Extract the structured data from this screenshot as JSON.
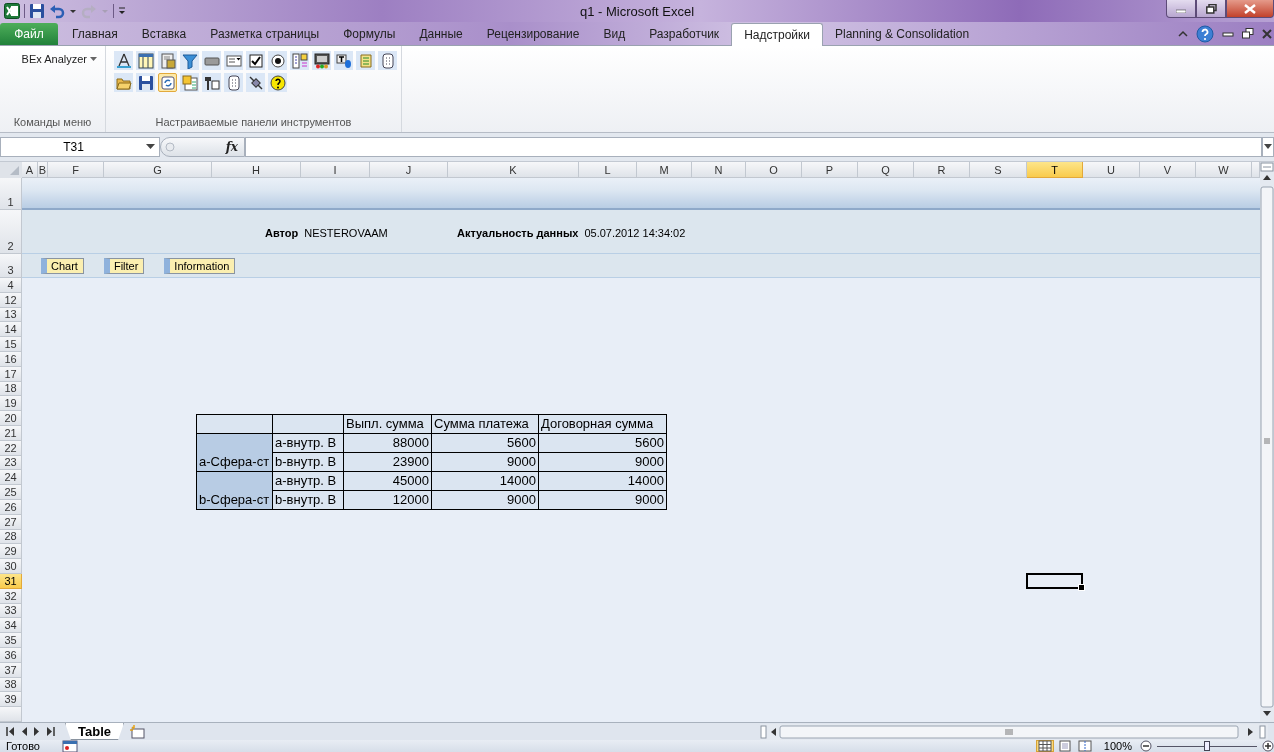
{
  "window": {
    "title": "q1  -  Microsoft Excel"
  },
  "ribbon_tabs": [
    {
      "label": "Файл",
      "selected": false,
      "kind": "file"
    },
    {
      "label": "Главная",
      "selected": false,
      "kind": "tab"
    },
    {
      "label": "Вставка",
      "selected": false,
      "kind": "tab"
    },
    {
      "label": "Разметка страницы",
      "selected": false,
      "kind": "tab"
    },
    {
      "label": "Формулы",
      "selected": false,
      "kind": "tab"
    },
    {
      "label": "Данные",
      "selected": false,
      "kind": "tab"
    },
    {
      "label": "Рецензирование",
      "selected": false,
      "kind": "tab"
    },
    {
      "label": "Вид",
      "selected": false,
      "kind": "tab"
    },
    {
      "label": "Разработчик",
      "selected": false,
      "kind": "tab"
    },
    {
      "label": "Надстройки",
      "selected": true,
      "kind": "tab"
    },
    {
      "label": "Planning & Consolidation",
      "selected": false,
      "kind": "tab"
    }
  ],
  "ribbon_groups": [
    {
      "label": "Команды меню",
      "kind": "menu",
      "button": "BEx Analyzer"
    },
    {
      "label": "Настраиваемые панели инструментов",
      "kind": "toolbar",
      "rows": [
        [
          {
            "selected": false
          },
          {
            "selected": false
          },
          {
            "selected": false
          },
          {
            "selected": false
          },
          {
            "selected": false
          },
          {
            "selected": false
          },
          {
            "selected": false
          },
          {
            "selected": false
          },
          {
            "selected": false
          },
          {
            "selected": false
          },
          {
            "selected": false
          },
          {
            "selected": false
          },
          {
            "selected": false
          }
        ],
        [
          {
            "selected": false
          },
          {
            "selected": false
          },
          {
            "selected": true
          },
          {
            "selected": false
          },
          {
            "selected": false
          },
          {
            "selected": false
          },
          {
            "selected": false
          },
          {
            "selected": false
          }
        ]
      ]
    }
  ],
  "formula_bar": {
    "name_box": "T31",
    "fx": "fx"
  },
  "sheet": {
    "columns": [
      {
        "label": "A",
        "selected": false
      },
      {
        "label": "B",
        "selected": false
      },
      {
        "label": "F",
        "selected": false
      },
      {
        "label": "G",
        "selected": false
      },
      {
        "label": "H",
        "selected": false
      },
      {
        "label": "I",
        "selected": false
      },
      {
        "label": "J",
        "selected": false
      },
      {
        "label": "K",
        "selected": false
      },
      {
        "label": "L",
        "selected": false
      },
      {
        "label": "M",
        "selected": false
      },
      {
        "label": "N",
        "selected": false
      },
      {
        "label": "O",
        "selected": false
      },
      {
        "label": "P",
        "selected": false
      },
      {
        "label": "Q",
        "selected": false
      },
      {
        "label": "R",
        "selected": false
      },
      {
        "label": "S",
        "selected": false
      },
      {
        "label": "T",
        "selected": true
      },
      {
        "label": "U",
        "selected": false
      },
      {
        "label": "V",
        "selected": false
      },
      {
        "label": "W",
        "selected": false
      }
    ],
    "rows": [
      {
        "label": "1",
        "selected": false
      },
      {
        "label": "2",
        "selected": false
      },
      {
        "label": "3",
        "selected": false
      },
      {
        "label": "4",
        "selected": false
      },
      {
        "label": "12",
        "selected": false
      },
      {
        "label": "13",
        "selected": false
      },
      {
        "label": "14",
        "selected": false
      },
      {
        "label": "15",
        "selected": false
      },
      {
        "label": "16",
        "selected": false
      },
      {
        "label": "17",
        "selected": false
      },
      {
        "label": "18",
        "selected": false
      },
      {
        "label": "19",
        "selected": false
      },
      {
        "label": "20",
        "selected": false
      },
      {
        "label": "21",
        "selected": false
      },
      {
        "label": "22",
        "selected": false
      },
      {
        "label": "23",
        "selected": false
      },
      {
        "label": "24",
        "selected": false
      },
      {
        "label": "25",
        "selected": false
      },
      {
        "label": "26",
        "selected": false
      },
      {
        "label": "27",
        "selected": false
      },
      {
        "label": "28",
        "selected": false
      },
      {
        "label": "29",
        "selected": false
      },
      {
        "label": "30",
        "selected": false
      },
      {
        "label": "31",
        "selected": true
      },
      {
        "label": "32",
        "selected": false
      },
      {
        "label": "33",
        "selected": false
      },
      {
        "label": "34",
        "selected": false
      },
      {
        "label": "35",
        "selected": false
      },
      {
        "label": "36",
        "selected": false
      },
      {
        "label": "37",
        "selected": false
      },
      {
        "label": "38",
        "selected": false
      },
      {
        "label": "39",
        "selected": false
      }
    ],
    "info": [
      {
        "label": "Автор",
        "value": "NESTEROVAAM"
      },
      {
        "label": "Актуальность данных",
        "value": "05.07.2012 14:34:02"
      }
    ],
    "nav_buttons": [
      "Chart",
      "Filter",
      "Information"
    ],
    "table": {
      "columns": [
        "Выпл. сумма",
        "Сумма платежа",
        "Договорная сумма"
      ],
      "groups": [
        {
          "label": "a-Сфера-ст",
          "rows": [
            {
              "label": "a-внутр. В",
              "values": [
                "88000",
                "5600",
                "5600"
              ]
            },
            {
              "label": "b-внутр. В",
              "values": [
                "23900",
                "9000",
                "9000"
              ]
            }
          ]
        },
        {
          "label": "b-Сфера-ст",
          "rows": [
            {
              "label": "a-внутр. В",
              "values": [
                "45000",
                "14000",
                "14000"
              ]
            },
            {
              "label": "b-внутр. В",
              "values": [
                "12000",
                "9000",
                "9000"
              ]
            }
          ]
        }
      ]
    }
  },
  "sheet_tabs": [
    {
      "label": "Table",
      "selected": true
    }
  ],
  "status_bar": {
    "text": "Готово",
    "views": [
      {
        "selected": true
      },
      {
        "selected": false
      },
      {
        "selected": false
      }
    ],
    "zoom": "100%",
    "zoom_slider": {
      "level": 0.5
    }
  }
}
